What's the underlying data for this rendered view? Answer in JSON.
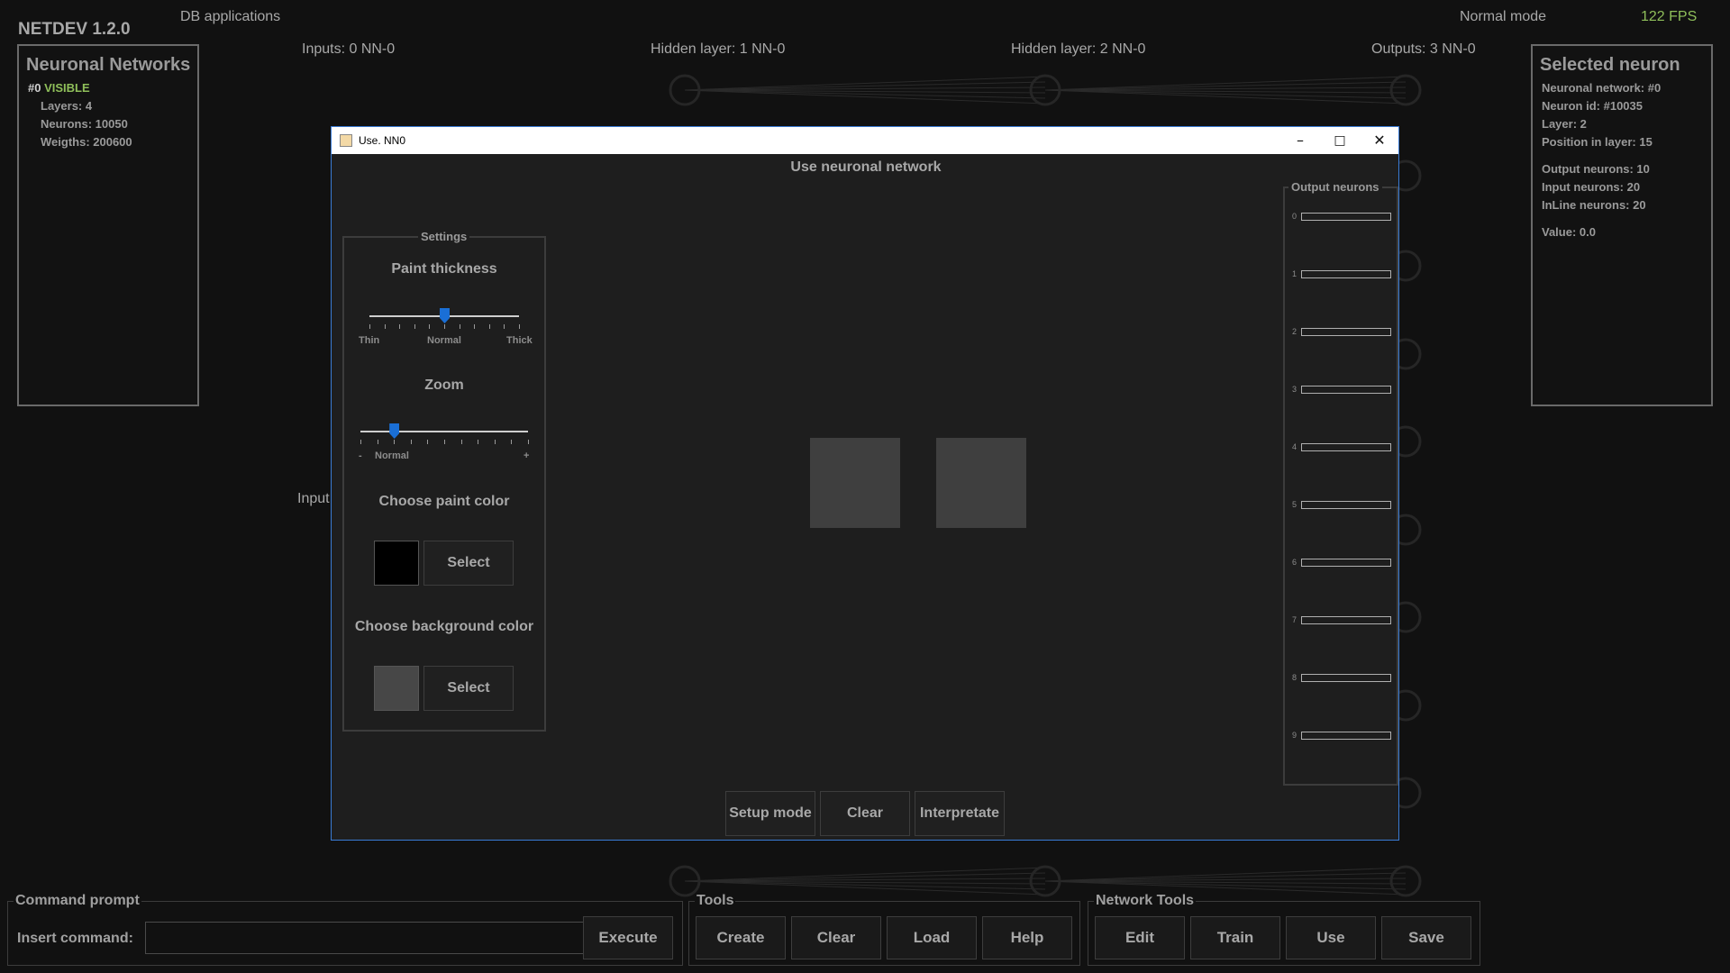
{
  "app": {
    "name": "NETDEV 1.2.0",
    "menu_db": "DB applications",
    "mode": "Normal mode",
    "fps": "122 FPS"
  },
  "layers": {
    "inputs": "Inputs: 0  NN-0",
    "hidden1": "Hidden layer: 1  NN-0",
    "hidden2": "Hidden layer: 2  NN-0",
    "outputs": "Outputs: 3  NN-0",
    "input_partial": "Input"
  },
  "networks_panel": {
    "title": "Neuronal Networks",
    "id": "#0",
    "status": "VISIBLE",
    "layers": "Layers: 4",
    "neurons": "Neurons: 10050",
    "weights": "Weigths: 200600"
  },
  "selected_panel": {
    "title": "Selected neuron",
    "network": "Neuronal network: #0",
    "neuron_id": "Neuron id: #10035",
    "layer": "Layer: 2",
    "position": "Position in layer: 15",
    "output_neurons": "Output neurons: 10",
    "input_neurons": "Input neurons: 20",
    "inline_neurons": "InLine neurons: 20",
    "value": "Value: 0.0"
  },
  "dialog": {
    "title": "Use. NN0",
    "heading": "Use neuronal network",
    "settings": {
      "legend": "Settings",
      "paint_thickness": "Paint thickness",
      "thickness_labels": [
        "Thin",
        "Normal",
        "Thick"
      ],
      "thickness_value": 0.5,
      "zoom": "Zoom",
      "zoom_labels": [
        "-",
        "Normal",
        "+"
      ],
      "zoom_value": 0.2,
      "paint_color_label": "Choose paint color",
      "paint_color": "#000000",
      "bg_color_label": "Choose background color",
      "bg_color": "#474747",
      "select_label": "Select"
    },
    "output_legend": "Output neurons",
    "outputs": [
      "0",
      "1",
      "2",
      "3",
      "4",
      "5",
      "6",
      "7",
      "8",
      "9"
    ],
    "canvas_color": "#3f3f3f",
    "buttons": {
      "setup": "Setup mode",
      "clear": "Clear",
      "interpretate": "Interpretate"
    }
  },
  "command": {
    "legend": "Command prompt",
    "label": "Insert command:",
    "value": "",
    "execute": "Execute"
  },
  "tools": {
    "legend": "Tools",
    "create": "Create",
    "clear": "Clear",
    "load": "Load",
    "help": "Help"
  },
  "network_tools": {
    "legend": "Network Tools",
    "edit": "Edit",
    "train": "Train",
    "use": "Use",
    "save": "Save"
  }
}
